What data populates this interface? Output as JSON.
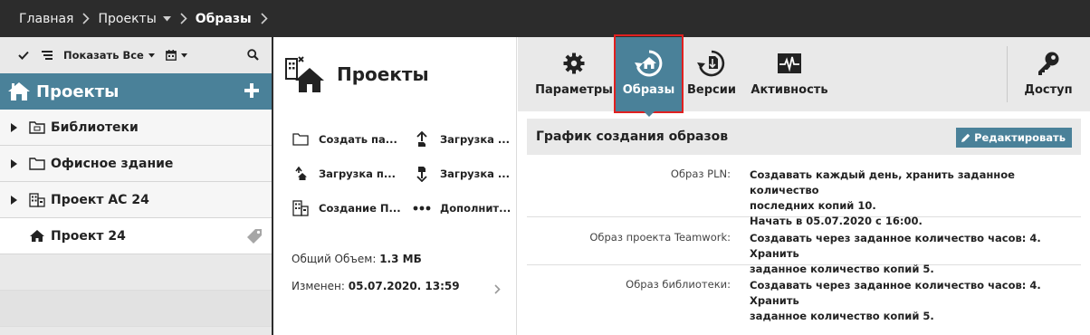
{
  "breadcrumb": {
    "home": "Главная",
    "projects": "Проекты",
    "current": "Образы"
  },
  "sidebar": {
    "toolbar": {
      "show_all": "Показать Все"
    },
    "header": {
      "title": "Проекты"
    },
    "items": [
      {
        "label": "Библиотеки",
        "expandable": true
      },
      {
        "label": "Офисное здание",
        "expandable": true
      },
      {
        "label": "Проект АС 24",
        "expandable": true
      },
      {
        "label": "Проект 24",
        "expandable": false,
        "active": true
      }
    ]
  },
  "middle": {
    "title": "Проекты",
    "actions": [
      {
        "label": "Создать па..."
      },
      {
        "label": "Загрузка ..."
      },
      {
        "label": "Загрузка п..."
      },
      {
        "label": "Загрузка ..."
      },
      {
        "label": "Создание П..."
      },
      {
        "label": "Дополнит..."
      }
    ],
    "info": {
      "size_label": "Общий Объем:",
      "size_value": "1.3 МБ",
      "modified_label": "Изменен:",
      "modified_value": "05.07.2020. 13:59"
    }
  },
  "tabs": [
    {
      "label": "Параметры",
      "icon": "gear-icon"
    },
    {
      "label": "Образы",
      "icon": "snapshot-icon",
      "selected": true
    },
    {
      "label": "Версии",
      "icon": "versions-icon"
    },
    {
      "label": "Активность",
      "icon": "activity-icon"
    },
    {
      "label": "Доступ",
      "icon": "key-icon"
    }
  ],
  "schedule": {
    "title": "График создания образов",
    "edit_label": "Редактировать",
    "rows": [
      {
        "label": "Образ PLN:",
        "lines": [
          "Создавать каждый день, хранить заданное количество",
          "последних копий 10.",
          "Начать в 05.07.2020 с 16:00."
        ]
      },
      {
        "label": "Образ проекта Teamwork:",
        "lines": [
          "Создавать через заданное количество часов: 4. Хранить",
          "заданное количество копий 5."
        ]
      },
      {
        "label": "Образ библиотеки:",
        "lines": [
          "Создавать через заданное количество часов: 4. Хранить",
          "заданное количество копий 5."
        ]
      }
    ]
  },
  "colors": {
    "topbar": "#2c2c2c",
    "accent": "#4a8199",
    "highlight_outline": "#e02020",
    "panel_grey": "#e9e9e9"
  }
}
